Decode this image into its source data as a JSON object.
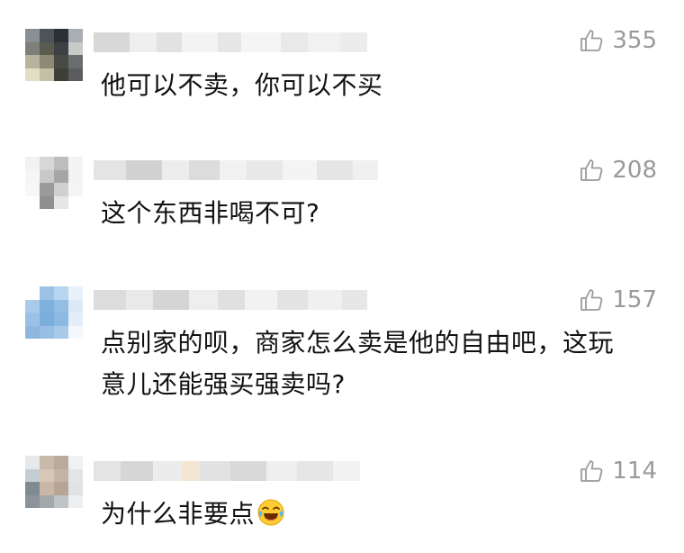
{
  "comments": [
    {
      "likes": "355",
      "text": "他可以不卖，你可以不买"
    },
    {
      "likes": "208",
      "text": "这个东西非喝不可?"
    },
    {
      "likes": "157",
      "text": "点别家的呗，商家怎么卖是他的自由吧，这玩",
      "text_line2": "意儿还能强买强卖吗?"
    },
    {
      "likes": "114",
      "text": "为什么非要点",
      "emoji": "laughing-with-tears-emoji"
    }
  ],
  "colors": {
    "like_gray": "#9a9a9a",
    "text": "#111111",
    "blur_gray": "#e8e8e8"
  }
}
